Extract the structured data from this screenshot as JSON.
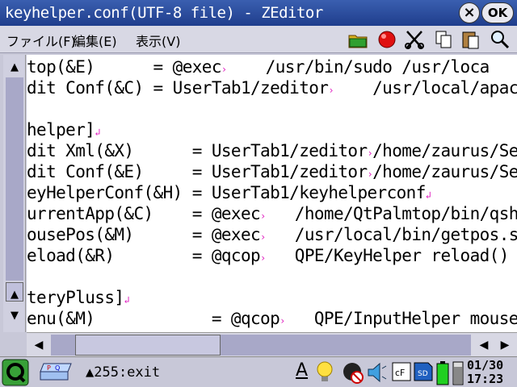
{
  "window": {
    "title": "keyhelper.conf(UTF-8 file) - ZEditor",
    "close_label": "×",
    "ok_label": "OK"
  },
  "menu": {
    "items": [
      "ファイル(F)",
      "編集(E)",
      "表示(V)"
    ]
  },
  "toolbar": {
    "icons": [
      "open-folder-icon",
      "record-icon",
      "cut-icon",
      "copy-icon",
      "paste-icon",
      "find-icon"
    ]
  },
  "editor": {
    "lines": [
      {
        "text": "top(&E)      = @exec",
        "tail": "    /usr/bin/sudo /usr/loca"
      },
      {
        "text": "dit Conf(&C) = UserTab1/zeditor",
        "tail": "    /usr/local/apac"
      },
      {
        "text": "",
        "tail": ""
      },
      {
        "text": "helper]",
        "tail": ""
      },
      {
        "text": "dit Xml(&X)      = UserTab1/zeditor",
        "tail": "/home/zaurus/Se"
      },
      {
        "text": "dit Conf(&E)     = UserTab1/zeditor",
        "tail": "/home/zaurus/Se"
      },
      {
        "text": "eyHelperConf(&H) = UserTab1/keyhelperconf",
        "tail": ""
      },
      {
        "text": "urrentApp(&C)    = @exec",
        "tail": "   /home/QtPalmtop/bin/qsh"
      },
      {
        "text": "ousePos(&M)      = @exec",
        "tail": "   /usr/local/bin/getpos.s"
      },
      {
        "text": "eload(&R)        = @qcop",
        "tail": "   QPE/KeyHelper reload()"
      },
      {
        "text": "",
        "tail": ""
      },
      {
        "text": "teryPluss]",
        "tail": ""
      },
      {
        "text": "enu(&M)            = @qcop",
        "tail": "   QPE/InputHelper mouse(Q"
      }
    ]
  },
  "taskbar": {
    "status": "▲255:exit",
    "input_label": "A",
    "clock_date": "01/30",
    "clock_time": "17:23"
  },
  "colors": {
    "title_bg": "#2a4ea0",
    "marker": "#e020c0",
    "scroll_track": "#a8a8c8"
  }
}
